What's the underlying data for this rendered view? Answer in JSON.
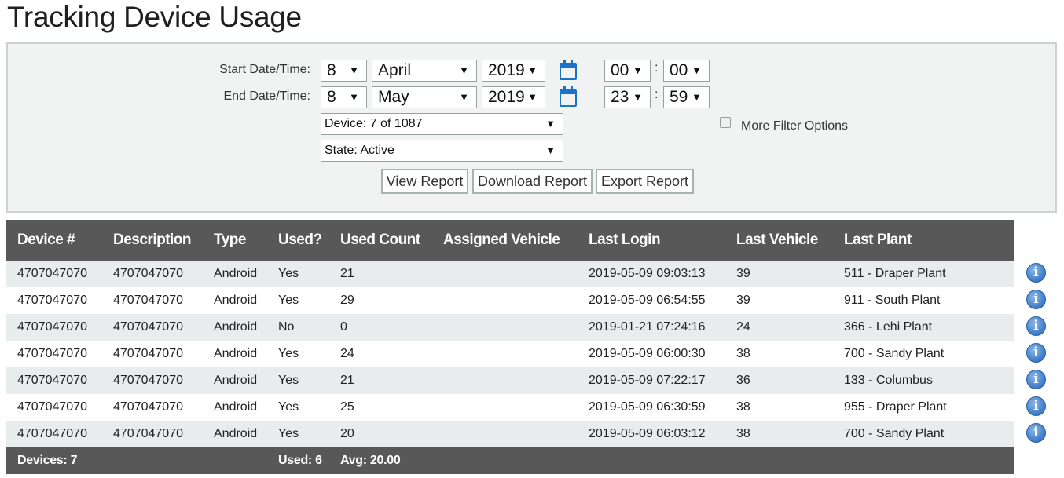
{
  "page": {
    "title": "Tracking Device Usage"
  },
  "filters": {
    "start_label": "Start Date/Time:",
    "end_label": "End Date/Time:",
    "start": {
      "day": "8",
      "month": "April",
      "year": "2019",
      "hour": "00",
      "minute": "00"
    },
    "end": {
      "day": "8",
      "month": "May",
      "year": "2019",
      "hour": "23",
      "minute": "59"
    },
    "time_separator": ":",
    "device_select": "Device: 7 of 1087",
    "state_select": "State: Active",
    "more_filter_label": "More Filter Options",
    "more_filter_checked": false,
    "dropdown_arrow": "▼",
    "buttons": {
      "view": "View Report",
      "download": "Download Report",
      "export": "Export Report"
    }
  },
  "table": {
    "columns": [
      "Device #",
      "Description",
      "Type",
      "Used?",
      "Used Count",
      "Assigned Vehicle",
      "Last Login",
      "Last Vehicle",
      "Last Plant"
    ],
    "rows": [
      [
        "4707047070",
        "4707047070",
        "Android",
        "Yes",
        "21",
        "",
        "2019-05-09 09:03:13",
        "39",
        "511 - Draper Plant"
      ],
      [
        "4707047070",
        "4707047070",
        "Android",
        "Yes",
        "29",
        "",
        "2019-05-09 06:54:55",
        "39",
        "911 - South Plant"
      ],
      [
        "4707047070",
        "4707047070",
        "Android",
        "No",
        "0",
        "",
        "2019-01-21 07:24:16",
        "24",
        "366 - Lehi Plant"
      ],
      [
        "4707047070",
        "4707047070",
        "Android",
        "Yes",
        "24",
        "",
        "2019-05-09 06:00:30",
        "38",
        "700 - Sandy Plant"
      ],
      [
        "4707047070",
        "4707047070",
        "Android",
        "Yes",
        "21",
        "",
        "2019-05-09 07:22:17",
        "36",
        "133 - Columbus"
      ],
      [
        "4707047070",
        "4707047070",
        "Android",
        "Yes",
        "25",
        "",
        "2019-05-09 06:30:59",
        "38",
        "955 - Draper Plant"
      ],
      [
        "4707047070",
        "4707047070",
        "Android",
        "Yes",
        "20",
        "",
        "2019-05-09 06:03:12",
        "38",
        "700 - Sandy Plant"
      ]
    ],
    "footer": {
      "devices": "Devices: 7",
      "used": "Used: 6",
      "avg": "Avg: 20.00"
    },
    "info_icon_glyph": "i"
  },
  "colors": {
    "header_bg": "#585858",
    "row_alt": "#e9ecec",
    "accent_blue": "#1a73c9",
    "panel_bg": "#f1f2f2"
  }
}
